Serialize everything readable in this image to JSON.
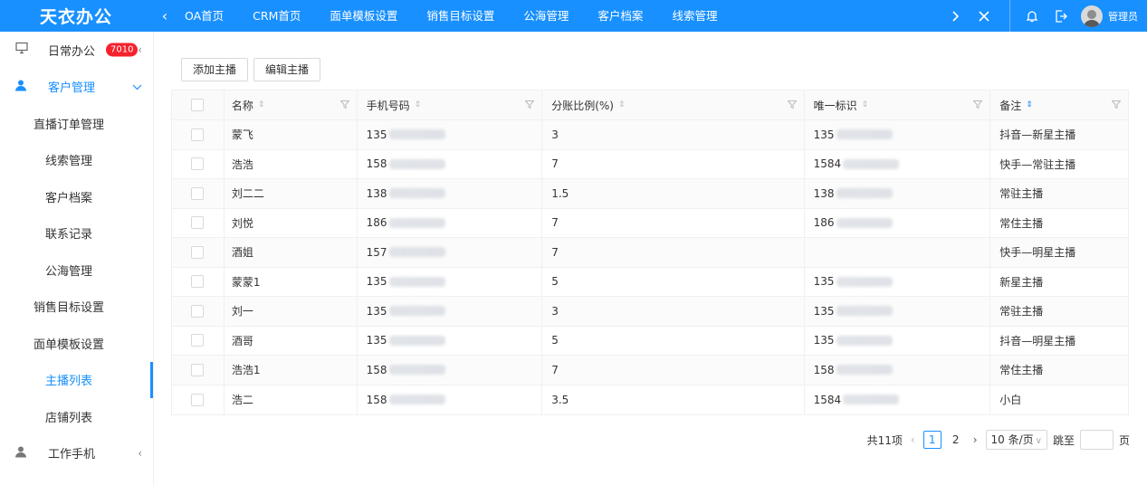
{
  "brand": "天衣办公",
  "nav": {
    "tabs": [
      "OA首页",
      "CRM首页",
      "面单模板设置",
      "销售目标设置",
      "公海管理",
      "客户档案",
      "线索管理"
    ],
    "admin_label": "管理员"
  },
  "sidebar": {
    "items": [
      {
        "label": "日常办公",
        "badge": "7010",
        "icon": "monitor-icon"
      },
      {
        "label": "客户管理",
        "icon": "user-icon"
      },
      {
        "label": "直播订单管理"
      },
      {
        "label": "线索管理"
      },
      {
        "label": "客户档案"
      },
      {
        "label": "联系记录"
      },
      {
        "label": "公海管理"
      },
      {
        "label": "销售目标设置"
      },
      {
        "label": "面单模板设置"
      },
      {
        "label": "主播列表"
      },
      {
        "label": "店铺列表"
      },
      {
        "label": "工作手机",
        "icon": "user-icon"
      }
    ]
  },
  "toolbar": {
    "add_label": "添加主播",
    "edit_label": "编辑主播"
  },
  "table": {
    "headers": [
      "名称",
      "手机号码",
      "分账比例(%)",
      "唯一标识",
      "备注"
    ],
    "rows": [
      {
        "name": "蒙飞",
        "phone": "135",
        "ratio": "3",
        "uid": "135",
        "note": "抖音—新星主播"
      },
      {
        "name": "浩浩",
        "phone": "158",
        "ratio": "7",
        "uid": "1584",
        "note": "快手—常驻主播"
      },
      {
        "name": "刘二二",
        "phone": "138",
        "ratio": "1.5",
        "uid": "138",
        "note": "常驻主播"
      },
      {
        "name": "刘悦",
        "phone": "186",
        "ratio": "7",
        "uid": "186",
        "note": "常住主播"
      },
      {
        "name": "酒姐",
        "phone": "157",
        "ratio": "7",
        "uid": "",
        "note": "快手—明星主播"
      },
      {
        "name": "蒙蒙1",
        "phone": "135",
        "ratio": "5",
        "uid": "135",
        "note": "新星主播"
      },
      {
        "name": "刘一",
        "phone": "135",
        "ratio": "3",
        "uid": "135",
        "note": "常驻主播"
      },
      {
        "name": "酒哥",
        "phone": "135",
        "ratio": "5",
        "uid": "135",
        "note": "抖音—明星主播"
      },
      {
        "name": "浩浩1",
        "phone": "158",
        "ratio": "7",
        "uid": "158",
        "note": "常住主播"
      },
      {
        "name": "浩二",
        "phone": "158",
        "ratio": "3.5",
        "uid": "1584",
        "note": "小白"
      }
    ]
  },
  "pagination": {
    "total": "共11项",
    "pages": [
      "1",
      "2"
    ],
    "page_size": "10 条/页",
    "jump_label": "跳至",
    "page_suffix": "页"
  },
  "colors": {
    "primary": "#1890ff",
    "badge": "#f5222d"
  }
}
